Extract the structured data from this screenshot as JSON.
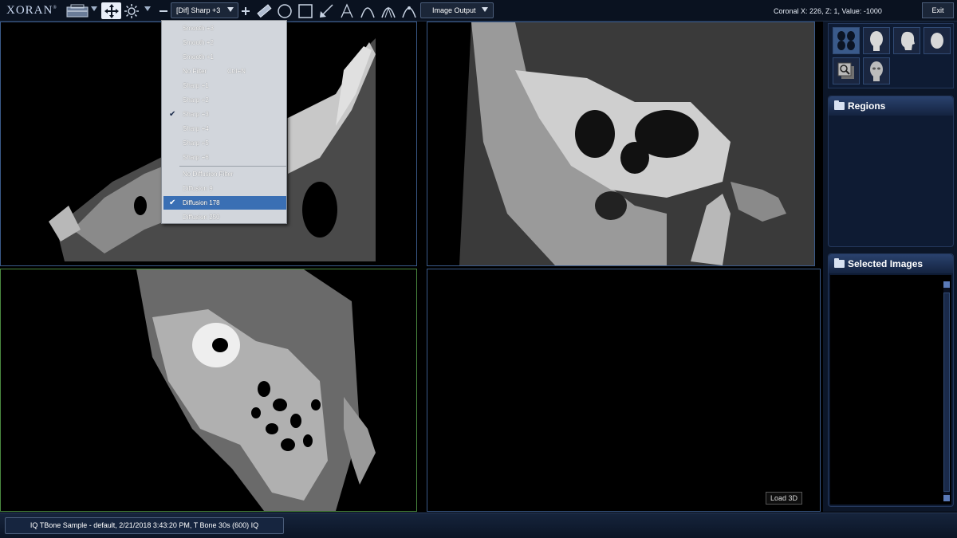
{
  "toolbar": {
    "logo": "XORAN",
    "logo_tm": "®",
    "filter_value": "[Dif] Sharp +3",
    "output_label": "Image Output",
    "coordinates": "Coronal  X: 226,  Z: 1,   Value: -1000",
    "exit_label": "Exit",
    "icons": [
      "toolbox-icon",
      "pan-icon",
      "brightness-icon",
      "minus-icon",
      "plus-icon",
      "ruler-icon",
      "ellipse-icon",
      "rectangle-icon",
      "arrow-icon",
      "text-icon",
      "arc-icon",
      "angle-icon",
      "curve-icon"
    ]
  },
  "filter_menu": {
    "items": [
      {
        "label": "Smooth +3",
        "checked": false,
        "selected": false,
        "shortcut": ""
      },
      {
        "label": "Smooth +2",
        "checked": false,
        "selected": false,
        "shortcut": ""
      },
      {
        "label": "Smooth +1",
        "checked": false,
        "selected": false,
        "shortcut": ""
      },
      {
        "label": "No Filter",
        "checked": false,
        "selected": false,
        "shortcut": "Ctrl+N"
      },
      {
        "label": "Sharp +1",
        "checked": false,
        "selected": false,
        "shortcut": ""
      },
      {
        "label": "Sharp +2",
        "checked": false,
        "selected": false,
        "shortcut": ""
      },
      {
        "label": "Sharp +3",
        "checked": true,
        "selected": false,
        "shortcut": ""
      },
      {
        "label": "Sharp +4",
        "checked": false,
        "selected": false,
        "shortcut": ""
      },
      {
        "label": "Sharp +5",
        "checked": false,
        "selected": false,
        "shortcut": ""
      },
      {
        "label": "Sharp +6",
        "checked": false,
        "selected": false,
        "shortcut": ""
      },
      {
        "label": "No Diffusion Filter",
        "checked": false,
        "selected": false,
        "shortcut": ""
      },
      {
        "label": "Diffusion 9",
        "checked": false,
        "selected": false,
        "shortcut": ""
      },
      {
        "label": "Diffusion 178",
        "checked": true,
        "selected": true,
        "shortcut": ""
      },
      {
        "label": "Diffusion 250",
        "checked": false,
        "selected": false,
        "shortcut": ""
      }
    ],
    "check_mark": "✔"
  },
  "viewports": {
    "load3d_label": "Load 3D"
  },
  "right_panel": {
    "layout_thumbs": [
      "four-up-layout-icon",
      "head-front-icon",
      "head-side-icon",
      "head-top-icon",
      "magnifier-stack-icon",
      "head-3d-icon"
    ],
    "regions_title": "Regions",
    "selected_images_title": "Selected Images"
  },
  "statusbar": {
    "text": "IQ TBone Sample - default, 2/21/2018 3:43:20 PM, T Bone 30s (600) IQ"
  },
  "colors": {
    "accent": "#3a6fb4",
    "panel_bg": "#0e1b33",
    "menu_bg": "#d2d6dc",
    "active_viewport_border": "#4a8a40"
  }
}
